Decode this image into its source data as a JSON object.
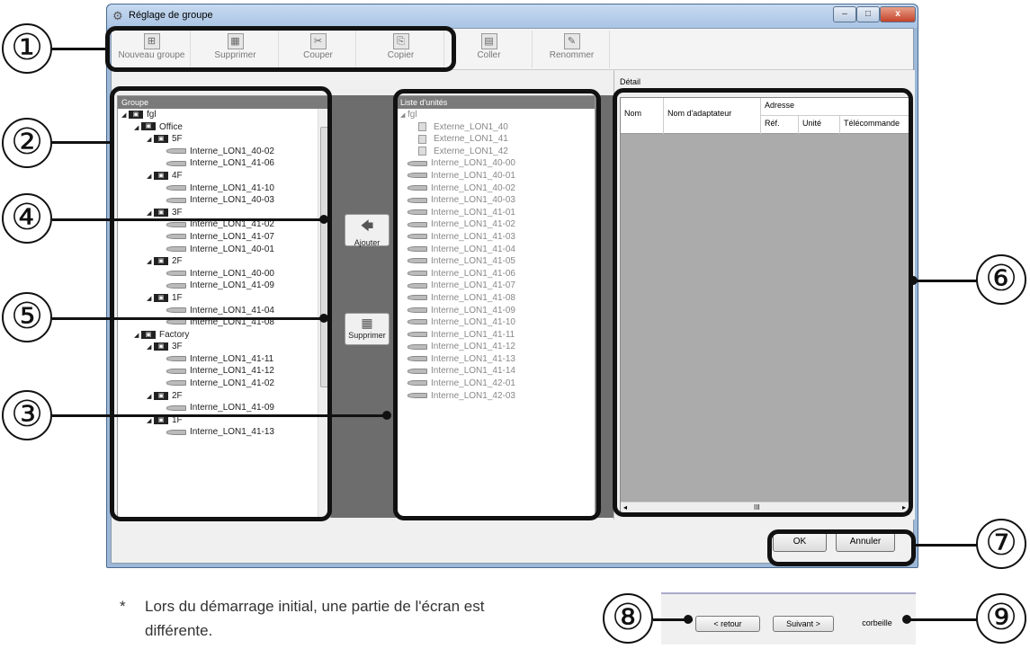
{
  "window": {
    "title": "Réglage de groupe",
    "controls": [
      "–",
      "□",
      "x"
    ]
  },
  "toolbar": {
    "items": [
      {
        "label": "Nouveau groupe",
        "icon": "new-group-icon"
      },
      {
        "label": "Supprimer",
        "icon": "delete-icon"
      },
      {
        "label": "Couper",
        "icon": "cut-icon"
      },
      {
        "label": "Copier",
        "icon": "copy-icon"
      },
      {
        "label": "Coller",
        "icon": "paste-icon"
      },
      {
        "label": "Renommer",
        "icon": "rename-icon"
      }
    ]
  },
  "groups_panel": {
    "header": "Groupe",
    "tree": [
      {
        "label": "fgl",
        "level": 0,
        "type": "folder"
      },
      {
        "label": "Office",
        "level": 1,
        "type": "folder"
      },
      {
        "label": "5F",
        "level": 2,
        "type": "folder"
      },
      {
        "label": "Interne_LON1_40-02",
        "level": 3,
        "type": "unit"
      },
      {
        "label": "Interne_LON1_41-06",
        "level": 3,
        "type": "unit"
      },
      {
        "label": "4F",
        "level": 2,
        "type": "folder"
      },
      {
        "label": "Interne_LON1_41-10",
        "level": 3,
        "type": "unit"
      },
      {
        "label": "Interne_LON1_40-03",
        "level": 3,
        "type": "unit"
      },
      {
        "label": "3F",
        "level": 2,
        "type": "folder"
      },
      {
        "label": "Interne_LON1_41-02",
        "level": 3,
        "type": "unit"
      },
      {
        "label": "Interne_LON1_41-07",
        "level": 3,
        "type": "unit"
      },
      {
        "label": "Interne_LON1_40-01",
        "level": 3,
        "type": "unit"
      },
      {
        "label": "2F",
        "level": 2,
        "type": "folder"
      },
      {
        "label": "Interne_LON1_40-00",
        "level": 3,
        "type": "unit"
      },
      {
        "label": "Interne_LON1_41-09",
        "level": 3,
        "type": "unit"
      },
      {
        "label": "1F",
        "level": 2,
        "type": "folder"
      },
      {
        "label": "Interne_LON1_41-04",
        "level": 3,
        "type": "unit"
      },
      {
        "label": "Interne_LON1_41-08",
        "level": 3,
        "type": "unit"
      },
      {
        "label": "Factory",
        "level": 1,
        "type": "folder"
      },
      {
        "label": "3F",
        "level": 2,
        "type": "folder"
      },
      {
        "label": "Interne_LON1_41-11",
        "level": 3,
        "type": "unit"
      },
      {
        "label": "Interne_LON1_41-12",
        "level": 3,
        "type": "unit"
      },
      {
        "label": "Interne_LON1_41-02",
        "level": 3,
        "type": "unit"
      },
      {
        "label": "2F",
        "level": 2,
        "type": "folder"
      },
      {
        "label": "Interne_LON1_41-09",
        "level": 3,
        "type": "unit"
      },
      {
        "label": "1F",
        "level": 2,
        "type": "folder"
      },
      {
        "label": "Interne_LON1_41-13",
        "level": 3,
        "type": "unit"
      }
    ]
  },
  "middle_buttons": {
    "add": "Ajouter",
    "remove": "Supprimer"
  },
  "units_panel": {
    "header": "Liste d'unités",
    "tree": [
      {
        "label": "fgl",
        "level": 0,
        "type": "root"
      },
      {
        "label": "Externe_LON1_40",
        "level": 1,
        "type": "outdoor"
      },
      {
        "label": "Externe_LON1_41",
        "level": 1,
        "type": "outdoor"
      },
      {
        "label": "Externe_LON1_42",
        "level": 1,
        "type": "outdoor"
      },
      {
        "label": "Interne_LON1_40-00",
        "level": 1,
        "type": "unit"
      },
      {
        "label": "Interne_LON1_40-01",
        "level": 1,
        "type": "unit"
      },
      {
        "label": "Interne_LON1_40-02",
        "level": 1,
        "type": "unit"
      },
      {
        "label": "Interne_LON1_40-03",
        "level": 1,
        "type": "unit"
      },
      {
        "label": "Interne_LON1_41-01",
        "level": 1,
        "type": "unit"
      },
      {
        "label": "Interne_LON1_41-02",
        "level": 1,
        "type": "unit"
      },
      {
        "label": "Interne_LON1_41-03",
        "level": 1,
        "type": "unit"
      },
      {
        "label": "Interne_LON1_41-04",
        "level": 1,
        "type": "unit"
      },
      {
        "label": "Interne_LON1_41-05",
        "level": 1,
        "type": "unit"
      },
      {
        "label": "Interne_LON1_41-06",
        "level": 1,
        "type": "unit"
      },
      {
        "label": "Interne_LON1_41-07",
        "level": 1,
        "type": "unit"
      },
      {
        "label": "Interne_LON1_41-08",
        "level": 1,
        "type": "unit"
      },
      {
        "label": "Interne_LON1_41-09",
        "level": 1,
        "type": "unit"
      },
      {
        "label": "Interne_LON1_41-10",
        "level": 1,
        "type": "unit"
      },
      {
        "label": "Interne_LON1_41-11",
        "level": 1,
        "type": "unit"
      },
      {
        "label": "Interne_LON1_41-12",
        "level": 1,
        "type": "unit"
      },
      {
        "label": "Interne_LON1_41-13",
        "level": 1,
        "type": "unit"
      },
      {
        "label": "Interne_LON1_41-14",
        "level": 1,
        "type": "unit"
      },
      {
        "label": "Interne_LON1_42-01",
        "level": 1,
        "type": "unit"
      },
      {
        "label": "Interne_LON1_42-03",
        "level": 1,
        "type": "unit"
      }
    ]
  },
  "detail": {
    "label": "Détail",
    "columns": {
      "nom": "Nom",
      "adapter": "Nom d'adaptateur",
      "adresse": "Adresse",
      "ref": "Réf.",
      "unite": "Unité",
      "remote": "Télécommande"
    },
    "scroll_mark": "III"
  },
  "buttons": {
    "ok": "OK",
    "cancel": "Annuler"
  },
  "callouts": [
    "①",
    "②",
    "③",
    "④",
    "⑤",
    "⑥",
    "⑦",
    "⑧",
    "⑨"
  ],
  "note": {
    "star": "*",
    "text": "Lors du démarrage initial, une partie de l'écran est différente."
  },
  "wizard": {
    "back": "< retour",
    "next": "Suivant >",
    "trash": "corbeille"
  }
}
